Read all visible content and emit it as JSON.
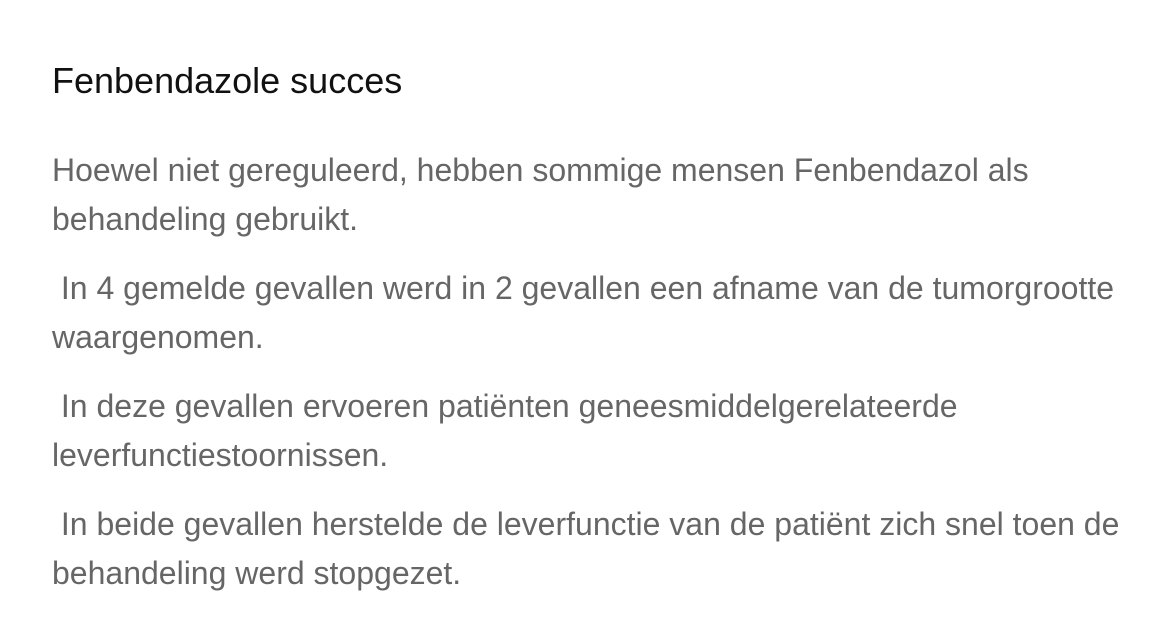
{
  "article": {
    "title": "Fenbendazole succes",
    "paragraphs": [
      "Hoewel niet gereguleerd, hebben sommige mensen Fenbendazol als behandeling gebruikt.",
      " In 4 gemelde gevallen werd in 2 gevallen een afname van de tumorgrootte waargenomen.",
      " In deze gevallen ervoeren patiënten geneesmiddelgerelateerde leverfunctiestoornissen.",
      " In beide gevallen herstelde de leverfunctie van de patiënt zich snel toen de behandeling werd stopgezet."
    ]
  }
}
